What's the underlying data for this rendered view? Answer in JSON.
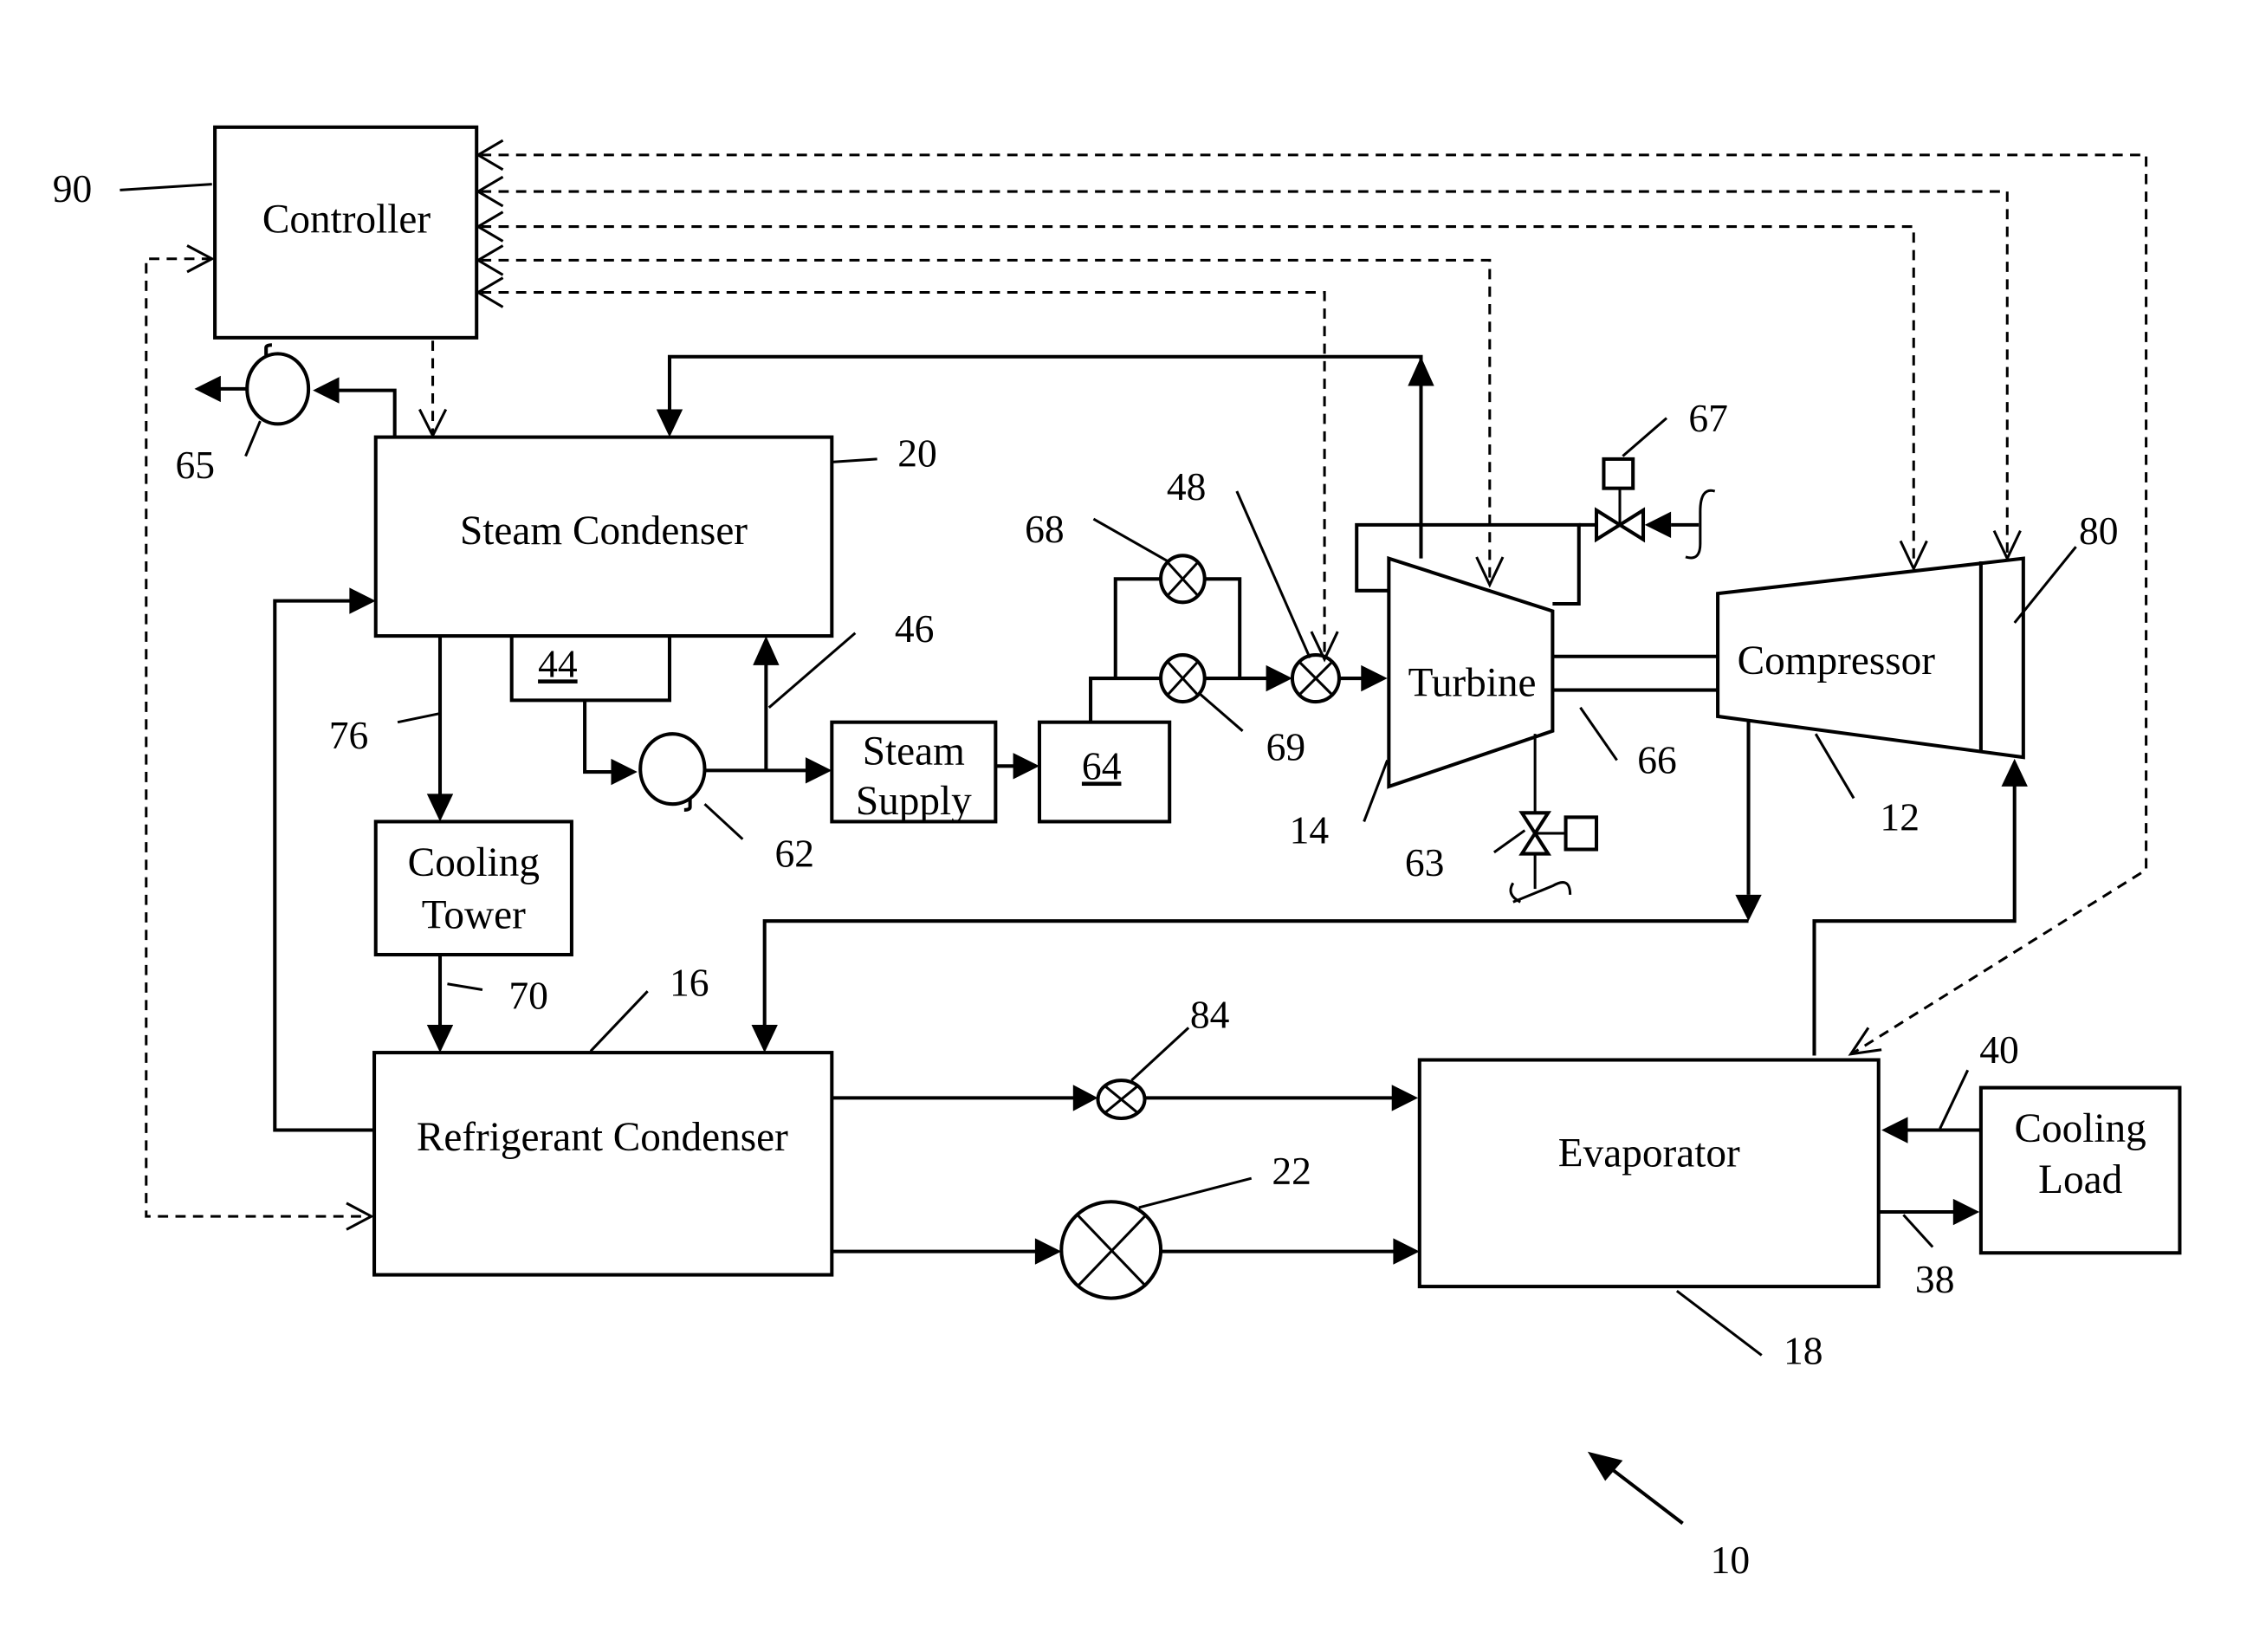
{
  "figure": {
    "system_ref": "10",
    "components": {
      "controller": {
        "label": "Controller",
        "ref": "90"
      },
      "steam_condenser": {
        "label": "Steam Condenser",
        "ref": "20"
      },
      "hotwell": {
        "label": "44"
      },
      "cooling_tower": {
        "label_line1": "Cooling",
        "label_line2": "Tower"
      },
      "refrigerant_condenser": {
        "label": "Refrigerant Condenser",
        "ref": "16"
      },
      "steam_supply": {
        "label_line1": "Steam",
        "label_line2": "Supply"
      },
      "boiler": {
        "label": "64"
      },
      "turbine": {
        "label": "Turbine",
        "ref": "14"
      },
      "compressor": {
        "label": "Compressor",
        "ref": "12"
      },
      "evaporator": {
        "label": "Evaporator",
        "ref": "18"
      },
      "cooling_load": {
        "label_line1": "Cooling",
        "label_line2": "Load"
      }
    },
    "reference_numerals": {
      "pump_vacuum": "65",
      "pump_feed": "62",
      "line_46": "46",
      "line_76": "76",
      "line_70": "70",
      "valve_68": "68",
      "valve_69": "69",
      "valve_48": "48",
      "valve_67": "67",
      "valve_63": "63",
      "shaft": "66",
      "inlet_guide_80": "80",
      "valve_84": "84",
      "expansion_22": "22",
      "line_40": "40",
      "line_38": "38"
    }
  }
}
